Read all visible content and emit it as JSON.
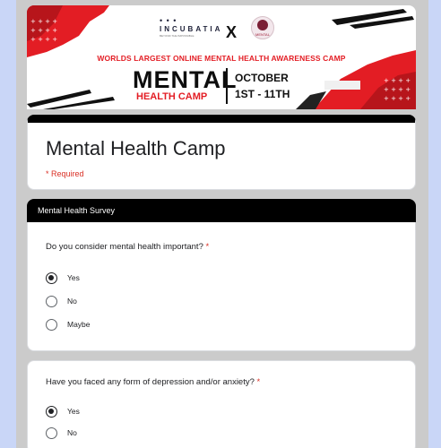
{
  "banner": {
    "brand_dots": "• • •",
    "brand": "INCUBATIA",
    "brand_sub": "BEYOND THE IMPOSSIBLE",
    "cross": "X",
    "partner_tag": "MENTAL",
    "campaign_line": "WORLDS LARGEST ONLINE MENTAL HEALTH AWARENESS CAMP",
    "headline": "MENTAL",
    "subheadline": "HEALTH CAMP",
    "month": "OCTOBER",
    "dates": "1ST - 11TH",
    "accent_color": "#e31d24"
  },
  "form": {
    "title": "Mental Health Camp",
    "required_note": "* Required"
  },
  "section": {
    "title": "Mental Health Survey"
  },
  "questions": [
    {
      "text": "Do you consider mental health important?",
      "required_mark": "*",
      "options": [
        {
          "label": "Yes",
          "selected": true
        },
        {
          "label": "No",
          "selected": false
        },
        {
          "label": "Maybe",
          "selected": false
        }
      ]
    },
    {
      "text": "Have you faced any form of depression and/or anxiety?",
      "required_mark": "*",
      "options": [
        {
          "label": "Yes",
          "selected": true
        },
        {
          "label": "No",
          "selected": false
        }
      ]
    }
  ]
}
